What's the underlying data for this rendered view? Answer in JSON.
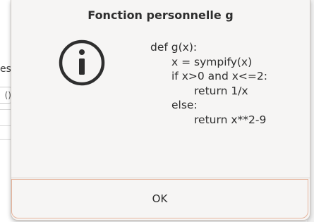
{
  "background": {
    "partial_text": "es",
    "partial_field_value": "()"
  },
  "dialog": {
    "title": "Fonction personnelle g",
    "icon": "info-circle-icon",
    "code_lines": [
      "def g(x):",
      "x = sympify(x)",
      "if x>0 and x<=2:",
      "return 1/x",
      "else:",
      "return x**2-9"
    ],
    "ok_label": "OK"
  },
  "colors": {
    "dialog_bg": "#f6f5f4",
    "focus_border": "#e6b49c",
    "text": "#2e2e2e"
  }
}
